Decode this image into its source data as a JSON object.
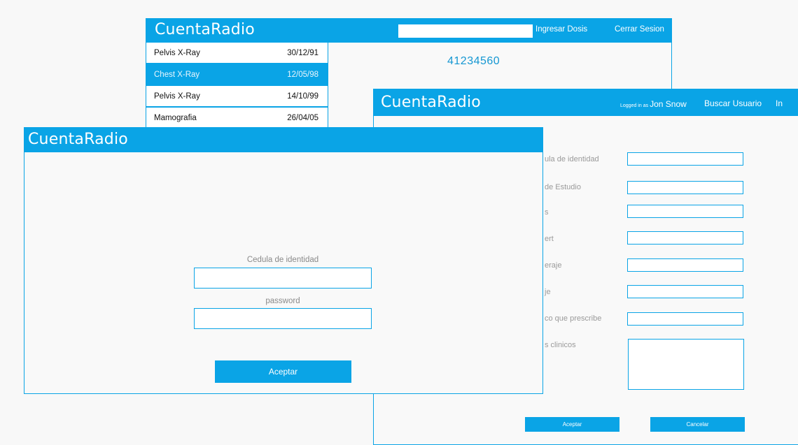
{
  "history_window": {
    "brand": "CuentaRadio",
    "search": {
      "value": ""
    },
    "nav": {
      "ingresar": "Ingresar Dosis",
      "cerrar": "Cerrar Sesion"
    },
    "studies": [
      {
        "name": "Pelvis X-Ray",
        "date": "30/12/91",
        "selected": false
      },
      {
        "name": "Chest X-Ray",
        "date": "12/05/98",
        "selected": true
      },
      {
        "name": "Pelvis X-Ray",
        "date": "14/10/99",
        "selected": false
      },
      {
        "name": "Mamografia",
        "date": "26/04/05",
        "selected": false
      }
    ],
    "patient_id": "41234560"
  },
  "study_window": {
    "brand": "CuentaRadio",
    "logged_in_prefix": "Logged in as",
    "user": "Jon Snow",
    "nav": {
      "buscar": "Buscar Usuario",
      "partial": "In"
    },
    "fields": [
      {
        "label": "ula de identidad"
      },
      {
        "label": "de Estudio"
      },
      {
        "label": "s"
      },
      {
        "label": "ert"
      },
      {
        "label": "eraje"
      },
      {
        "label": "je"
      },
      {
        "label": "co que prescribe"
      }
    ],
    "notes_label": "s clinicos",
    "accept": "Aceptar",
    "cancel": "Cancelar"
  },
  "login_window": {
    "brand": "CuentaRadio",
    "id_label": "Cedula de identidad",
    "password_label": "password",
    "id_value": "",
    "password_value": "",
    "submit": "Aceptar"
  },
  "colors": {
    "accent": "#0aa4e6",
    "panel": "#f9f9f9"
  }
}
